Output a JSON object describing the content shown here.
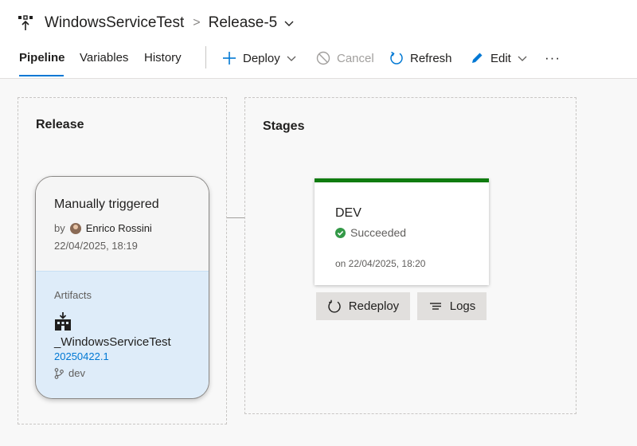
{
  "header": {
    "breadcrumb": [
      "WindowsServiceTest",
      "Release-5"
    ]
  },
  "tabs": [
    {
      "label": "Pipeline",
      "active": true
    },
    {
      "label": "Variables",
      "active": false
    },
    {
      "label": "History",
      "active": false
    }
  ],
  "commands": {
    "deploy": "Deploy",
    "cancel": "Cancel",
    "refresh": "Refresh",
    "edit": "Edit",
    "more": "···"
  },
  "release_panel": {
    "title": "Release",
    "trigger": "Manually triggered",
    "by_label": "by",
    "user": "Enrico Rossini",
    "date": "22/04/2025, 18:19",
    "artifacts_label": "Artifacts",
    "artifact_name": "_WindowsServiceTest",
    "artifact_build": "20250422.1",
    "branch": "dev"
  },
  "stages_panel": {
    "title": "Stages",
    "stage": {
      "name": "DEV",
      "status": "Succeeded",
      "time": "on 22/04/2025, 18:20"
    },
    "redeploy_label": "Redeploy",
    "logs_label": "Logs"
  },
  "colors": {
    "accent": "#0078d4",
    "success": "#107c10",
    "artifact_bg": "#deecf9"
  },
  "icons": {
    "pipeline": "release-pipeline-icon",
    "deploy": "plus-icon",
    "cancel": "cancel-icon",
    "refresh": "refresh-icon",
    "edit": "pencil-icon",
    "artifact": "build-artifact-icon",
    "branch": "git-branch-icon",
    "success": "check-circle-icon",
    "redeploy": "redeploy-icon",
    "logs": "logs-icon"
  }
}
